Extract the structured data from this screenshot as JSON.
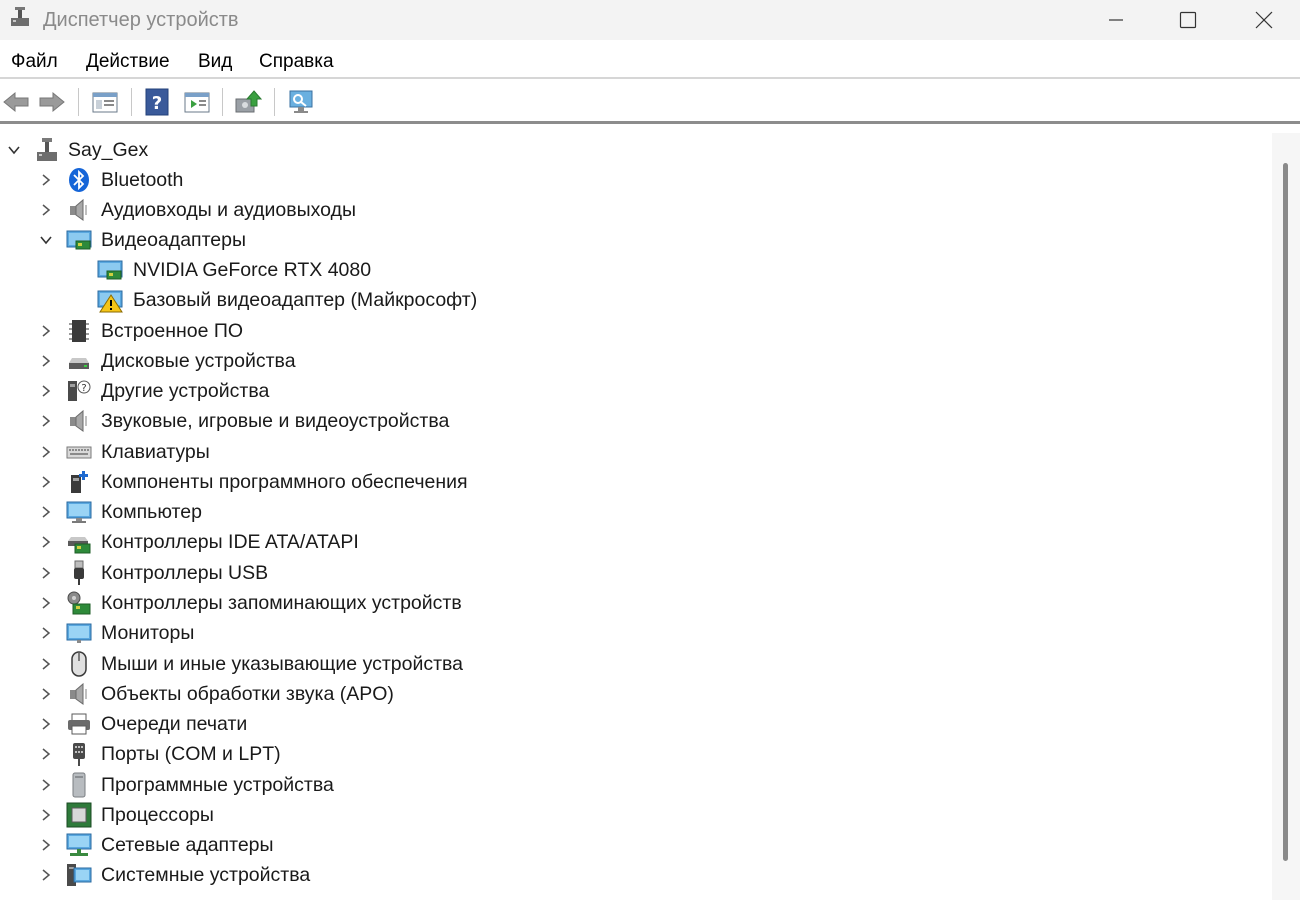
{
  "window": {
    "title": "Диспетчер устройств"
  },
  "menu": {
    "file": "Файл",
    "action": "Действие",
    "view": "Вид",
    "help": "Справка"
  },
  "toolbar": {
    "icons": [
      "back-arrow-icon",
      "forward-arrow-icon",
      "properties-panel-icon",
      "help-icon",
      "run-panel-icon",
      "update-driver-icon",
      "scan-hardware-icon"
    ]
  },
  "tree": {
    "root": "Say_Gex",
    "categories": [
      {
        "label": "Bluetooth",
        "icon": "bluetooth-icon",
        "expanded": false
      },
      {
        "label": "Аудиовходы и аудиовыходы",
        "icon": "speaker-icon",
        "expanded": false
      },
      {
        "label": "Видеоадаптеры",
        "icon": "display-adapter-icon",
        "expanded": true,
        "children": [
          {
            "label": "NVIDIA GeForce RTX 4080",
            "icon": "display-adapter-icon"
          },
          {
            "label": "Базовый видеоадаптер (Майкрософт)",
            "icon": "display-adapter-warning-icon"
          }
        ]
      },
      {
        "label": "Встроенное ПО",
        "icon": "firmware-chip-icon",
        "expanded": false
      },
      {
        "label": "Дисковые устройства",
        "icon": "disk-drive-icon",
        "expanded": false
      },
      {
        "label": "Другие устройства",
        "icon": "unknown-device-icon",
        "expanded": false
      },
      {
        "label": "Звуковые, игровые и видеоустройства",
        "icon": "speaker-icon",
        "expanded": false
      },
      {
        "label": "Клавиатуры",
        "icon": "keyboard-icon",
        "expanded": false
      },
      {
        "label": "Компоненты программного обеспечения",
        "icon": "software-component-icon",
        "expanded": false
      },
      {
        "label": "Компьютер",
        "icon": "computer-icon",
        "expanded": false
      },
      {
        "label": "Контроллеры IDE ATA/ATAPI",
        "icon": "ide-controller-icon",
        "expanded": false
      },
      {
        "label": "Контроллеры USB",
        "icon": "usb-icon",
        "expanded": false
      },
      {
        "label": "Контроллеры запоминающих устройств",
        "icon": "storage-controller-icon",
        "expanded": false
      },
      {
        "label": "Мониторы",
        "icon": "monitor-icon",
        "expanded": false
      },
      {
        "label": "Мыши и иные указывающие устройства",
        "icon": "mouse-icon",
        "expanded": false
      },
      {
        "label": "Объекты обработки звука (APO)",
        "icon": "speaker-icon",
        "expanded": false
      },
      {
        "label": "Очереди печати",
        "icon": "printer-icon",
        "expanded": false
      },
      {
        "label": "Порты (COM и LPT)",
        "icon": "port-icon",
        "expanded": false
      },
      {
        "label": "Программные устройства",
        "icon": "software-device-icon",
        "expanded": false
      },
      {
        "label": "Процессоры",
        "icon": "processor-icon",
        "expanded": false
      },
      {
        "label": "Сетевые адаптеры",
        "icon": "network-adapter-icon",
        "expanded": false
      },
      {
        "label": "Системные устройства",
        "icon": "system-devices-icon",
        "expanded": false
      }
    ]
  }
}
